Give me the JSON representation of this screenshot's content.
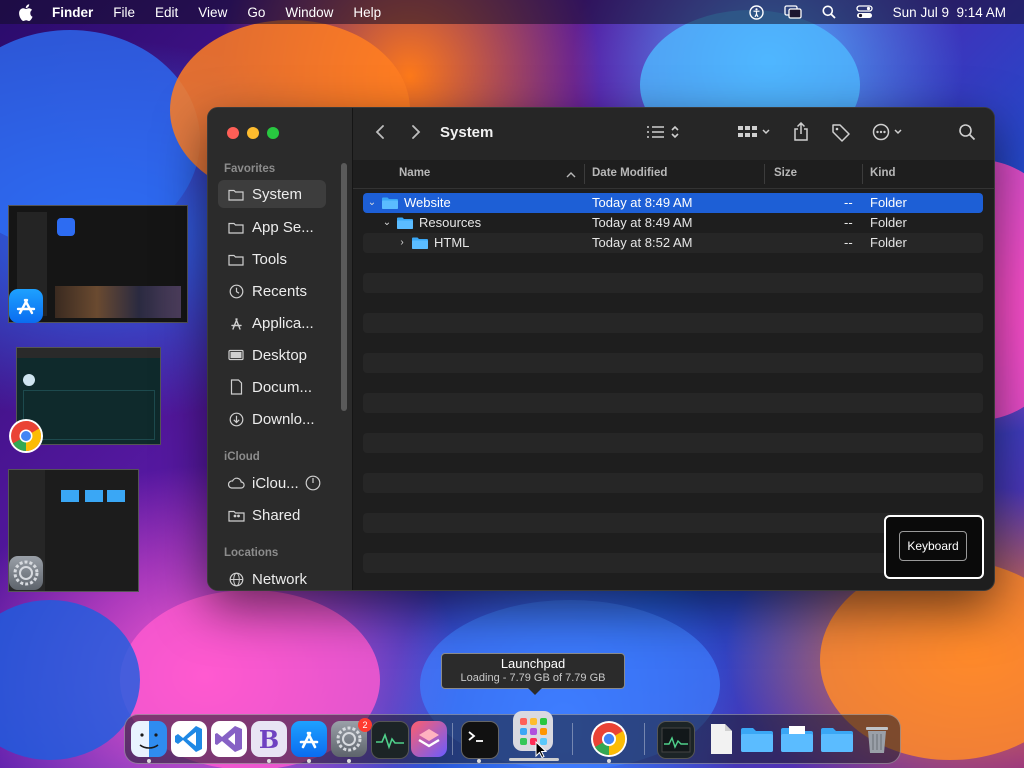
{
  "menubar": {
    "app_name": "Finder",
    "menus": [
      "File",
      "Edit",
      "View",
      "Go",
      "Window",
      "Help"
    ],
    "clock": "Sun Jul 9  9:14 AM",
    "status_icons": [
      "accessibility-icon",
      "screen-mirroring-icon",
      "spotlight-icon",
      "control-center-icon"
    ]
  },
  "finder": {
    "title": "System",
    "sidebar": {
      "favorites_header": "Favorites",
      "favorites": [
        {
          "label": "System",
          "icon": "folder-icon",
          "active": true
        },
        {
          "label": "App Se...",
          "icon": "folder-icon"
        },
        {
          "label": "Tools",
          "icon": "folder-icon"
        },
        {
          "label": "Recents",
          "icon": "clock-icon"
        },
        {
          "label": "Applica...",
          "icon": "applications-icon"
        },
        {
          "label": "Desktop",
          "icon": "desktop-icon"
        },
        {
          "label": "Docum...",
          "icon": "document-icon"
        },
        {
          "label": "Downlo...",
          "icon": "download-icon"
        }
      ],
      "icloud_header": "iCloud",
      "icloud": [
        {
          "label": "iClou...",
          "icon": "cloud-icon"
        },
        {
          "label": "Shared",
          "icon": "shared-folder-icon"
        }
      ],
      "locations_header": "Locations",
      "locations": [
        {
          "label": "Network",
          "icon": "globe-icon"
        }
      ]
    },
    "columns": {
      "name": "Name",
      "date": "Date Modified",
      "size": "Size",
      "kind": "Kind"
    },
    "rows": [
      {
        "name": "Website",
        "date": "Today at 8:49 AM",
        "size": "--",
        "kind": "Folder",
        "expanded": true,
        "selected": true
      },
      {
        "name": "Resources",
        "date": "Today at 8:49 AM",
        "size": "--",
        "kind": "Folder",
        "expanded": true
      },
      {
        "name": "HTML",
        "date": "Today at 8:52 AM",
        "size": "--",
        "kind": "Folder",
        "expanded": false
      }
    ]
  },
  "keyboard_overlay": {
    "label": "Keyboard"
  },
  "tooltip": {
    "title": "Launchpad",
    "subtitle": "Loading - 7.79 GB of 7.79 GB"
  },
  "dock": {
    "apps": [
      "Finder",
      "Visual Studio Code",
      "Visual Studio",
      "Bootstrap Studio",
      "App Store",
      "System Settings",
      "Activity Monitor",
      "Shortcuts",
      "Terminal",
      "Launchpad",
      "Google Chrome",
      "Activity Monitor",
      "Document",
      "Folder",
      "Folder",
      "Folder",
      "Trash"
    ],
    "settings_badge": "2"
  },
  "colors": {
    "selection": "#1d5fd6",
    "folder_blue": "#3aa7f5",
    "close": "#ff5f57",
    "minimize": "#febc2e",
    "zoom": "#28c840"
  }
}
